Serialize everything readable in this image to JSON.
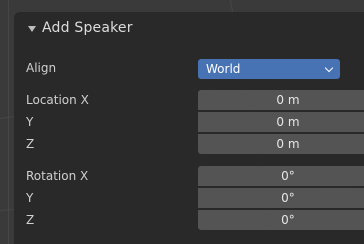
{
  "panel": {
    "title": "Add Speaker"
  },
  "rows": {
    "align": {
      "label": "Align",
      "value": "World"
    },
    "location": {
      "x": {
        "label": "Location X",
        "value": "0 m"
      },
      "y": {
        "label": "Y",
        "value": "0 m"
      },
      "z": {
        "label": "Z",
        "value": "0 m"
      }
    },
    "rotation": {
      "x": {
        "label": "Rotation X",
        "value": "0°"
      },
      "y": {
        "label": "Y",
        "value": "0°"
      },
      "z": {
        "label": "Z",
        "value": "0°"
      }
    }
  },
  "colors": {
    "panel_bg": "#282828",
    "field_bg": "#545454",
    "accent": "#4772b3",
    "text": "#e6e6e6"
  },
  "icons": {
    "collapse": "triangle-down-icon",
    "dropdown": "chevron-down-icon"
  }
}
